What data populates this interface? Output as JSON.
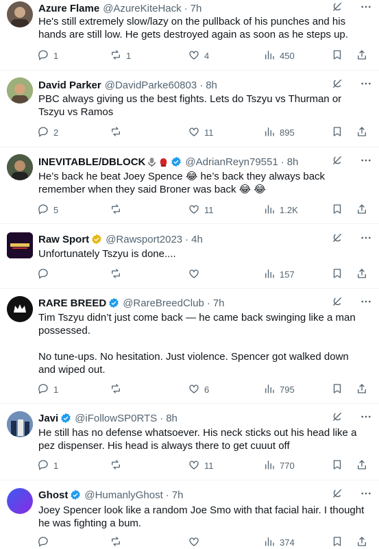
{
  "posts": [
    {
      "name": "Azure Flame",
      "handle": "@AzureKiteHack",
      "time": "7h",
      "text": "He's still extremely slow/lazy on the pullback of his punches and his hands are still low. He gets destroyed again as soon as he steps up.",
      "replies": "1",
      "reposts": "1",
      "likes": "4",
      "views": "450",
      "avatar_color": "#6b5a4e",
      "verified": false
    },
    {
      "name": "David Parker",
      "handle": "@DavidParke60803",
      "time": "8h",
      "text": "PBC always giving us the best fights. Lets do Tszyu vs Thurman or Tszyu vs Ramos",
      "replies": "2",
      "reposts": "",
      "likes": "11",
      "views": "895",
      "avatar_color": "#8a7558",
      "verified": false
    },
    {
      "name": "INEVITABLE/DBLOCK",
      "handle": "@AdrianReyn79551",
      "time": "8h",
      "text": "He’s back he beat Joey Spence 😂 he’s back they always back remember when they said Broner was back 😂 😂",
      "replies": "5",
      "reposts": "",
      "likes": "11",
      "views": "1.2K",
      "avatar_color": "#3f4a3a",
      "verified": true,
      "name_emojis": [
        "microphone-emoji",
        "boxing-glove-emoji"
      ]
    },
    {
      "name": "Raw Sport",
      "handle": "@Rawsport2023",
      "time": "4h",
      "text": "Unfortunately Tszyu is done....",
      "replies": "",
      "reposts": "",
      "likes": "",
      "views": "157",
      "avatar_color": "#2b0f3a",
      "verified": true,
      "badge_color": "#e2b719"
    },
    {
      "name": "RARE BREED",
      "handle": "@RareBreedClub",
      "time": "7h",
      "text": "Tim Tszyu didn’t just come back — he came back swinging like a man possessed.\n\nNo tune-ups. No hesitation. Just violence. Spencer got walked down and wiped out.",
      "replies": "1",
      "reposts": "",
      "likes": "6",
      "views": "795",
      "avatar_color": "#111111",
      "verified": true
    },
    {
      "name": "Javi",
      "handle": "@iFollowSP0RTS",
      "time": "8h",
      "text": "He still has no defense whatsoever. His neck sticks out his head like a pez dispenser. His head is always there to get cuuut off",
      "replies": "1",
      "reposts": "",
      "likes": "11",
      "views": "770",
      "avatar_color": "#3a5b8c",
      "verified": true
    },
    {
      "name": "Ghost",
      "handle": "@HumanlyGhost",
      "time": "7h",
      "text": "Joey Spencer look like a random Joe Smo with that facial hair. I thought he was fighting a bum.",
      "replies": "",
      "reposts": "",
      "likes": "",
      "views": "374",
      "avatar_color": "#5b3de0",
      "verified": true
    }
  ],
  "colors": {
    "text": "#0f1419",
    "muted": "#536471",
    "verified": "#1d9bf0",
    "divider": "#eff3f4"
  },
  "icons": [
    "grok-icon",
    "more-icon",
    "reply-icon",
    "repost-icon",
    "like-icon",
    "views-icon",
    "bookmark-icon",
    "share-icon"
  ]
}
